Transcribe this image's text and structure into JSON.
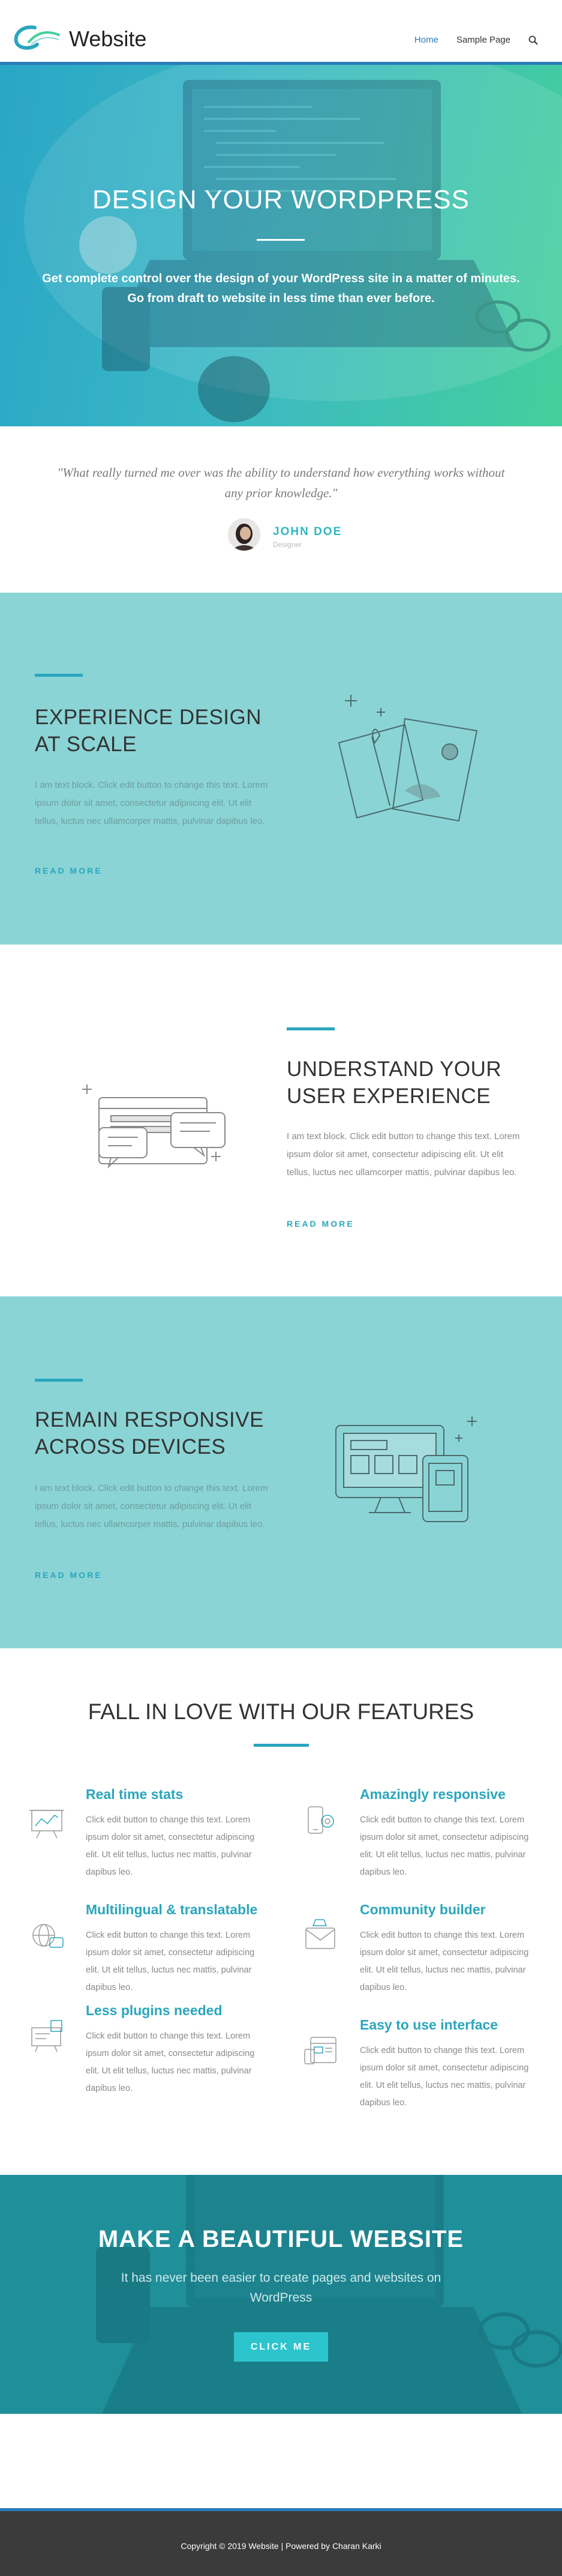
{
  "header": {
    "site_title": "Website",
    "nav": [
      {
        "label": "Home",
        "active": true
      },
      {
        "label": "Sample Page",
        "active": false
      }
    ],
    "search_icon": "search-icon",
    "accent": "#2b7bb9"
  },
  "hero": {
    "title": "DESIGN YOUR WORDPRESS",
    "subtitle": "Get complete control over the design of your WordPress site in a matter of minutes. Go from draft to website in less time than ever before."
  },
  "testimonial": {
    "quote": "\"What really turned me over was the ability to understand how everything works without any prior knowledge.\"",
    "name": "JOHN DOE",
    "role": "Designer"
  },
  "sections": [
    {
      "title_line1": "EXPERIENCE DESIGN",
      "title_line2": "AT SCALE",
      "text": "I am text block. Click edit button to change this text. Lorem ipsum dolor sit amet, consectetur adipiscing elit. Ut elit tellus, luctus nec ullamcorper mattis, pulvinar dapibus leo.",
      "link": "READ MORE",
      "icon": "design-tools-icon"
    },
    {
      "title_line1": "UNDERSTAND YOUR",
      "title_line2": "USER EXPERIENCE",
      "text": "I am text block. Click edit button to change this text. Lorem ipsum dolor sit amet, consectetur adipiscing elit. Ut elit tellus, luctus nec ullamcorper mattis, pulvinar dapibus leo.",
      "link": "READ MORE",
      "icon": "chat-window-icon"
    },
    {
      "title_line1": "REMAIN RESPONSIVE",
      "title_line2": "ACROSS DEVICES",
      "text": "I am text block. Click edit button to change this text. Lorem ipsum dolor sit amet, consectetur adipiscing elit. Ut elit tellus, luctus nec ullamcorper mattis, pulvinar dapibus leo.",
      "link": "READ MORE",
      "icon": "devices-icon"
    }
  ],
  "features": {
    "title": "FALL IN LOVE WITH OUR FEATURES",
    "items": [
      {
        "title": "Real time stats",
        "text": "Click edit button to change this text. Lorem ipsum dolor sit amet, consectetur adipiscing elit. Ut elit tellus, luctus nec mattis, pulvinar dapibus leo.",
        "icon": "stats-board-icon"
      },
      {
        "title": "Amazingly responsive",
        "text": "Click edit button to change this text. Lorem ipsum dolor sit amet, consectetur adipiscing elit. Ut elit tellus, luctus nec mattis, pulvinar dapibus leo.",
        "icon": "phone-gear-icon"
      },
      {
        "title": "Multilingual & translatable",
        "text": "Click edit button to change this text. Lorem ipsum dolor sit amet, consectetur adipiscing elit. Ut elit tellus, luctus nec mattis, pulvinar dapibus leo.",
        "icon": "globe-icon"
      },
      {
        "title": "Community builder",
        "text": "Click edit button to change this text. Lorem ipsum dolor sit amet, consectetur adipiscing elit. Ut elit tellus, luctus nec mattis, pulvinar dapibus leo.",
        "icon": "mail-icon"
      },
      {
        "title": "Less plugins needed",
        "text": "Click edit button to change this text. Lorem ipsum dolor sit amet, consectetur adipiscing elit. Ut elit tellus, luctus nec mattis, pulvinar dapibus leo.",
        "icon": "plugin-board-icon"
      },
      {
        "title": "Easy to use interface",
        "text": "Click edit button to change this text. Lorem ipsum dolor sit amet, consectetur adipiscing elit. Ut elit tellus, luctus nec mattis, pulvinar dapibus leo.",
        "icon": "interface-icon"
      }
    ]
  },
  "cta": {
    "title": "MAKE A BEAUTIFUL WEBSITE",
    "subtitle": "It has never been easier to create pages and websites on WordPress",
    "button": "CLICK ME"
  },
  "footer": {
    "text": "Copyright © 2019 Website | Powered by Charan Karki"
  }
}
